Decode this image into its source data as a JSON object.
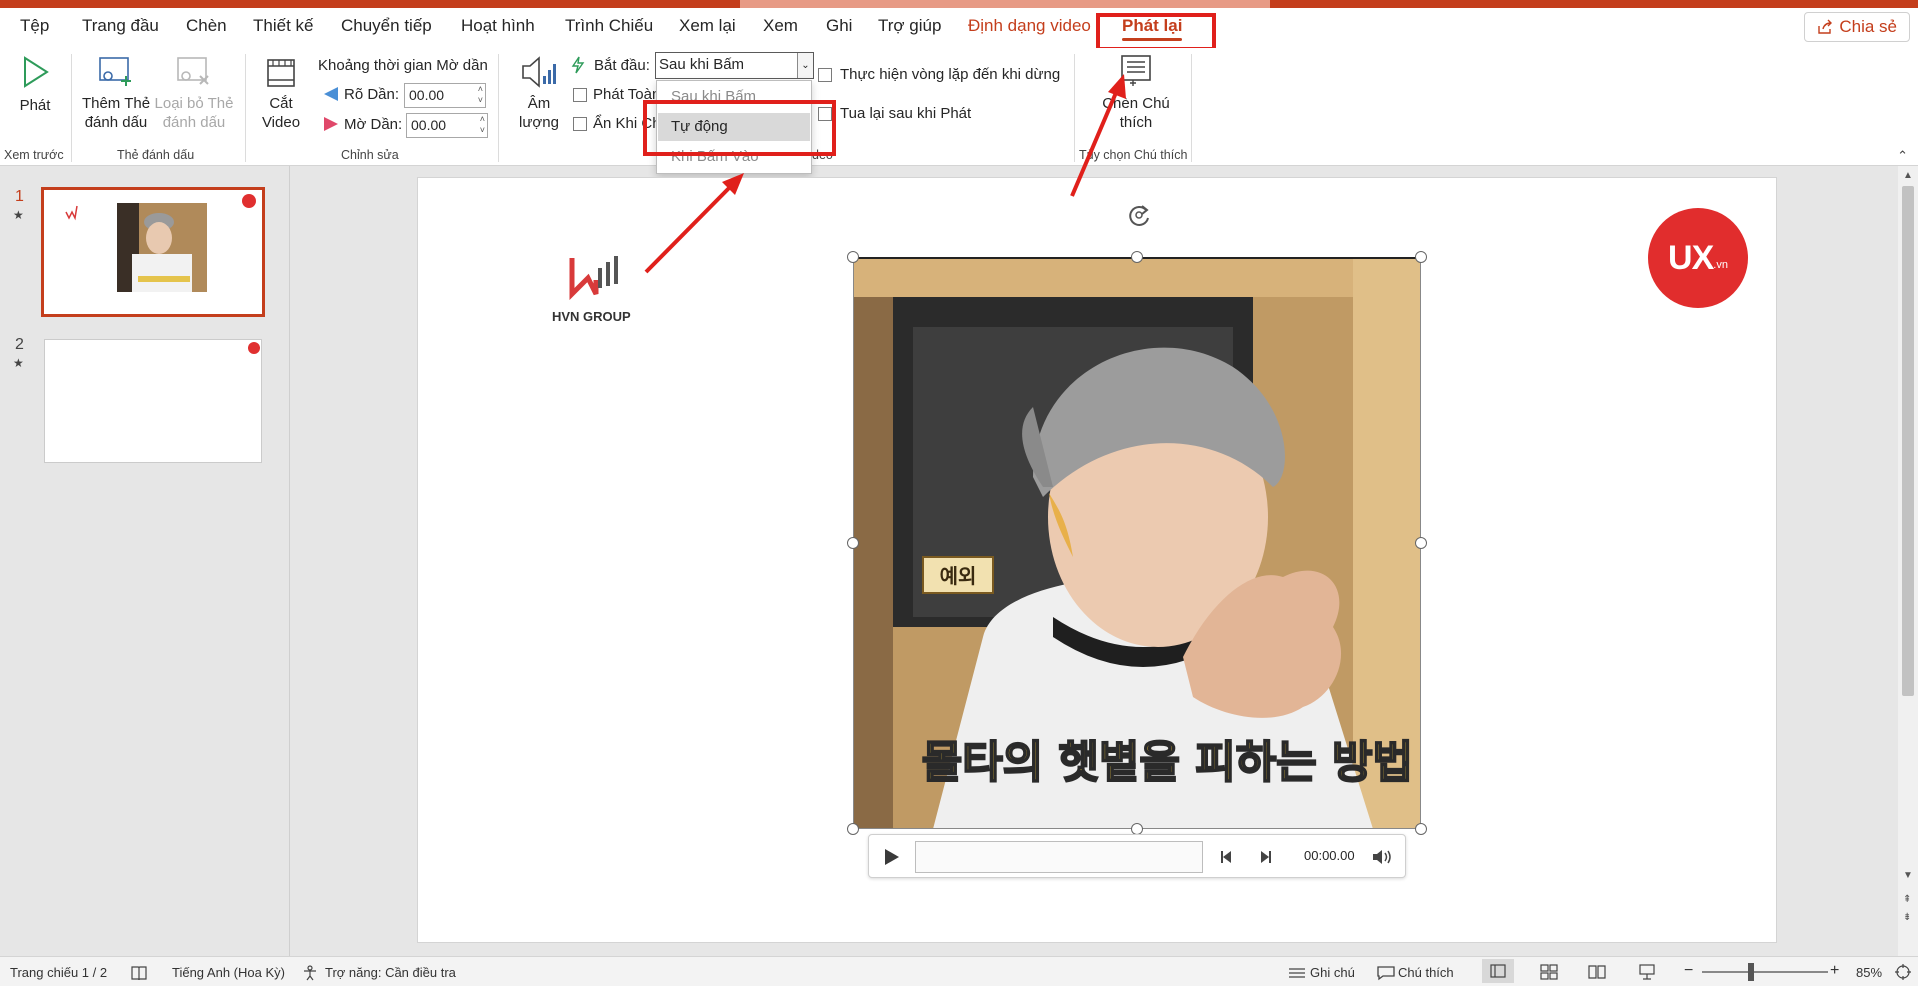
{
  "tabs": [
    "Tệp",
    "Trang đầu",
    "Chèn",
    "Thiết kế",
    "Chuyển tiếp",
    "Hoạt hình",
    "Trình Chiếu",
    "Xem lại",
    "Xem",
    "Ghi",
    "Trợ giúp",
    "Định dạng video",
    "Phát lại"
  ],
  "share_label": "Chia sẻ",
  "ribbon": {
    "play_label": "Phát",
    "preview_group": "Xem trước",
    "add_bookmark_line1": "Thêm Thẻ",
    "add_bookmark_line2": "đánh dấu",
    "remove_bookmark_line1": "Loại bỏ Thẻ",
    "remove_bookmark_line2": "đánh dấu",
    "bookmarks_group": "Thẻ đánh dấu",
    "trim_line1": "Cắt",
    "trim_line2": "Video",
    "fade_title": "Khoảng thời gian Mờ dần",
    "fade_in_label": "Rõ Dần:",
    "fade_in_value": "00.00",
    "fade_out_label": "Mờ Dần:",
    "fade_out_value": "00.00",
    "editing_group": "Chỉnh sửa",
    "volume_line1": "Âm",
    "volume_line2": "lượng",
    "start_label": "Bắt đầu:",
    "start_value": "Sau khi Bấm",
    "fullscreen_label": "Phát Toàn",
    "hide_label": "Ẩn Khi Ch",
    "loop_label": "Thực hiện vòng lặp đến khi dừng",
    "rewind_label": "Tua lại sau khi Phát",
    "video_options_group_fragment": "deo",
    "insert_caption_line1": "Chèn Chú",
    "insert_caption_line2": "thích",
    "caption_group": "Tùy chọn Chú thích"
  },
  "dropdown_options": [
    "Sau khi Bấm",
    "Tự động",
    "Khi Bấm Vào"
  ],
  "slides": [
    {
      "number": "1",
      "mark": "★"
    },
    {
      "number": "2",
      "mark": "★"
    }
  ],
  "slide_content": {
    "logo_text": "HVN GROUP",
    "ux_logo_text": "UX",
    "ux_logo_suffix": ".vn",
    "video_name_tag": "예외",
    "video_subtitle": "몰타의 햇볕을 피하는 방법"
  },
  "player": {
    "time": "00:00.00"
  },
  "status": {
    "slide_counter": "Trang chiếu 1 / 2",
    "language": "Tiếng Anh (Hoa Kỳ)",
    "accessibility": "Trợ năng: Cần điều tra",
    "notes": "Ghi chú",
    "comments": "Chú thích",
    "zoom": "85%"
  },
  "colors": {
    "accent": "#c43e1c",
    "annotation_red": "#e0201b"
  }
}
